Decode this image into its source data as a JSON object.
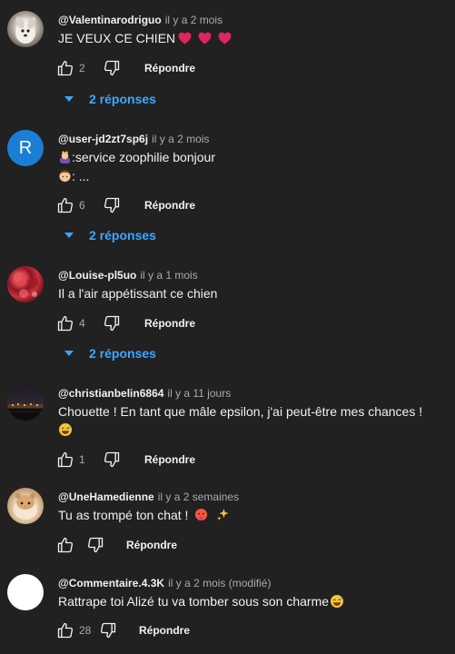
{
  "colors": {
    "background": "#212121",
    "link": "#3ea6ff",
    "secondary": "#aaaaaa"
  },
  "reply_label": "Répondre",
  "comments": [
    {
      "author": "@Valentinarodriguo",
      "time": "il y a 2 mois",
      "text": "JE VEUX CE CHIEN",
      "emoji_after": [
        "red-heart",
        "red-heart",
        "red-heart"
      ],
      "likes": "2",
      "replies": "2 réponses",
      "avatar": "dog-photo"
    },
    {
      "author": "@user-jd2zt7sp6j",
      "time": "il y a 2 mois",
      "avatar_letter": "R",
      "avatar_color": "#1a7fd4",
      "line1_emoji": "woman-with-crown",
      "line1": ":service zoophilie bonjour",
      "line2_emoji": "man-face",
      "line2": ": ...",
      "likes": "6",
      "replies": "2 réponses"
    },
    {
      "author": "@Louise-pl5uo",
      "time": "il y a 1 mois",
      "text": "Il a l'air appétissant ce chien",
      "likes": "4",
      "replies": "2 réponses",
      "avatar": "red-pattern"
    },
    {
      "author": "@christianbelin6864",
      "time": "il y a 11 jours",
      "text": "Chouette ! En tant que mâle epsilon, j'ai peut-être mes chances !",
      "line2_emoji": "grinning-sweat",
      "likes": "1",
      "avatar": "night-city"
    },
    {
      "author": "@UneHamedienne",
      "time": "il y a 2 semaines",
      "text": "Tu as trompé ton chat !",
      "emoji_after": [
        "hot-face",
        "sparkles"
      ],
      "avatar": "hamster-photo"
    },
    {
      "author": "@Commentaire.4.3K",
      "time": "il y a 2 mois (modifié)",
      "text": "Rattrape toi Alizé tu va tomber sous son charme",
      "emoji_after": [
        "grinning-sweat"
      ],
      "likes": "28",
      "avatar": "blank-white"
    }
  ]
}
